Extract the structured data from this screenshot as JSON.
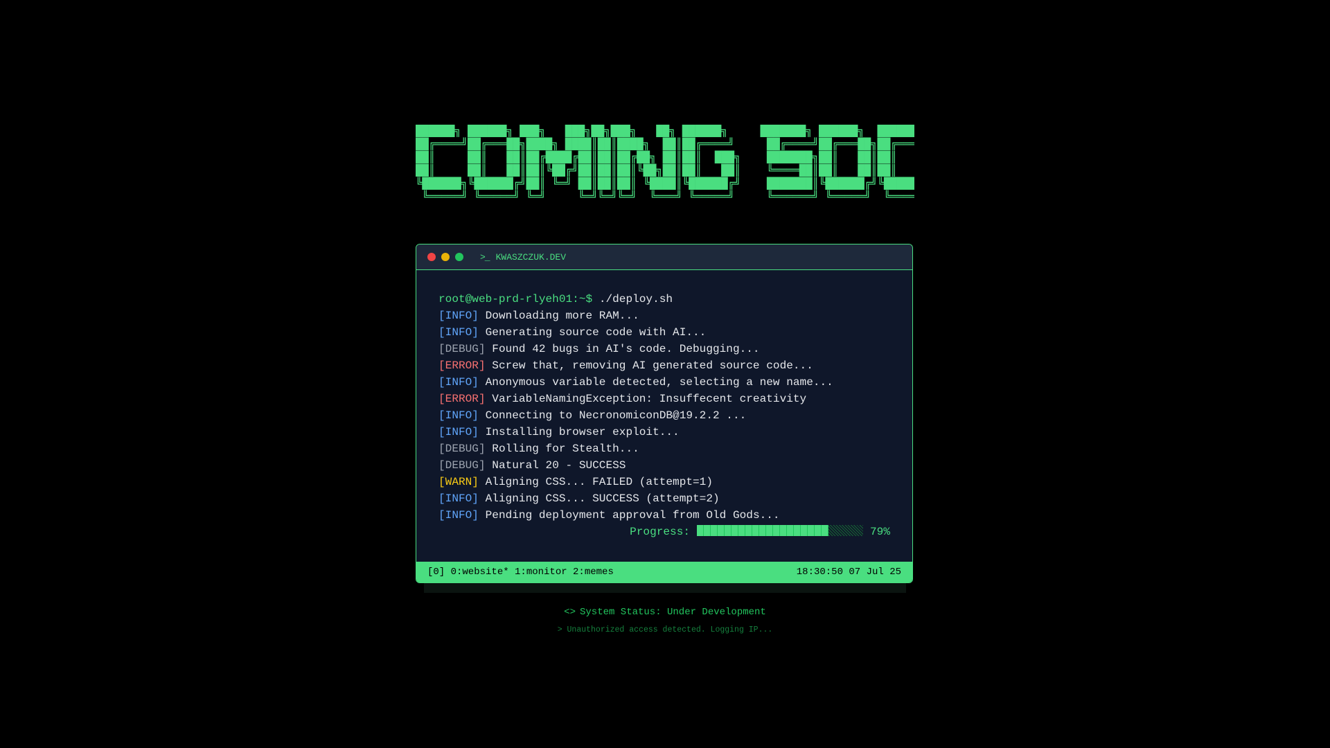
{
  "banner": {
    "art": "██████╗ ██████╗ ███╗   ███╗██╗███╗   ██╗ ██████╗     ███████╗ ██████╗  ██████╗ ███╗   ██╗\n██╔════╝██╔═══██╗████╗ ████║██║████╗  ██║██╔════╝     ██╔════╝██╔═══██╗██╔═══██╗████╗  ██║\n██║     ██║   ██║██╔████╔██║██║██╔██╗ ██║██║  ███╗    ███████╗██║   ██║██║   ██║██╔██╗ ██║\n██║     ██║   ██║██║╚██╔╝██║██║██║╚██╗██║██║   ██║    ╚════██║██║   ██║██║   ██║██║╚██╗██║\n╚██████╗╚██████╔╝██║ ╚═╝ ██║██║██║ ╚████║╚██████╔╝    ███████║╚██████╔╝╚██████╔╝██║ ╚████║\n ╚═════╝ ╚═════╝ ╚═╝     ╚═╝╚═╝╚═╝  ╚═══╝ ╚═════╝     ╚══════╝ ╚═════╝  ╚═════╝ ╚═╝  ╚═══╝"
  },
  "window": {
    "title": "KWASZCZUK.DEV",
    "title_icon": "terminal-prompt-icon",
    "controls": [
      "close",
      "minimize",
      "maximize"
    ]
  },
  "terminal": {
    "prompt": "root@web-prd-rlyeh01:~$",
    "command": "./deploy.sh",
    "lines": [
      {
        "tag": "[INFO]",
        "message": "Downloading more RAM..."
      },
      {
        "tag": "[INFO]",
        "message": "Generating source code with AI..."
      },
      {
        "tag": "[DEBUG]",
        "message": "Found 42 bugs in AI's code. Debugging..."
      },
      {
        "tag": "[ERROR]",
        "message": "Screw that, removing AI generated source code..."
      },
      {
        "tag": "[INFO]",
        "message": "Anonymous variable detected, selecting a new name..."
      },
      {
        "tag": "[ERROR]",
        "message": "VariableNamingException: Insuffecent creativity"
      },
      {
        "tag": "[INFO]",
        "message": "Connecting to NecronomiconDB@19.2.2 ..."
      },
      {
        "tag": "[INFO]",
        "message": "Installing browser exploit..."
      },
      {
        "tag": "[DEBUG]",
        "message": "Rolling for Stealth..."
      },
      {
        "tag": "[DEBUG]",
        "message": "Natural 20 - SUCCESS"
      },
      {
        "tag": "[WARN]",
        "message": "Aligning CSS... FAILED (attempt=1)"
      },
      {
        "tag": "[INFO]",
        "message": "Aligning CSS... SUCCESS (attempt=2)"
      },
      {
        "tag": "[INFO]",
        "message": "Pending deployment approval from Old Gods..."
      }
    ],
    "progress": {
      "label": "Progress:",
      "value": 0.79,
      "text": "79%"
    }
  },
  "statusbar": {
    "windows": "[0] 0:website* 1:monitor 2:memes",
    "clock": "18:30:50 07 Jul 25"
  },
  "footer": {
    "status_icon": "<>",
    "status": "System Status: Under Development",
    "warning": "> Unauthorized access detected. Logging IP..."
  },
  "colors": {
    "accent": "#4ade80",
    "info": "#60a5fa",
    "debug": "#9ca3af",
    "error": "#f87171",
    "warn": "#facc15",
    "terminal_bg": "#0f172a"
  }
}
